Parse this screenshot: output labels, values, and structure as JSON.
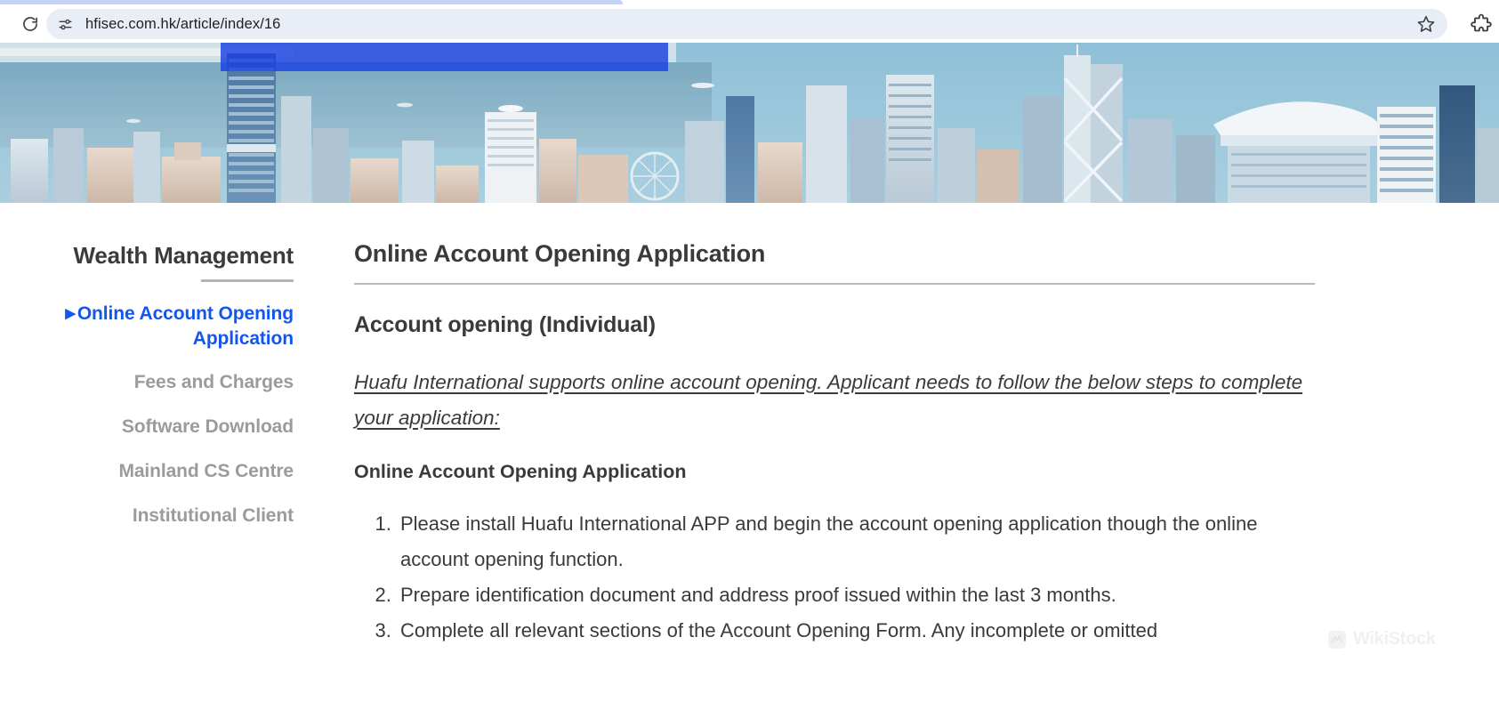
{
  "browser": {
    "reload_icon": "reload-icon",
    "site_info_icon": "site-info-icon",
    "url": "hfisec.com.hk/article/index/16",
    "bookmark_icon": "star-outline-icon",
    "extensions_icon": "puzzle-piece-icon"
  },
  "hero": {
    "alt": "Hong Kong Victoria Harbour skyline banner",
    "selection_color": "#1a3fe0"
  },
  "sidebar": {
    "title": "Wealth Management",
    "items": [
      {
        "label": "Online Account Opening Application",
        "active": true,
        "marker": "▶"
      },
      {
        "label": "Fees and Charges",
        "active": false
      },
      {
        "label": "Software Download",
        "active": false
      },
      {
        "label": "Mainland CS Centre",
        "active": false
      },
      {
        "label": "Institutional Client",
        "active": false
      }
    ],
    "active_color": "#1355ef",
    "inactive_color": "#9b9b9b"
  },
  "article": {
    "title": "Online Account Opening Application",
    "subtitle": "Account opening (Individual)",
    "intro": "Huafu International supports online account opening. Applicant needs to follow the below steps to complete your application:",
    "section_heading": "Online Account Opening Application",
    "steps": [
      "Please install Huafu International APP and begin the account opening application though the online account opening function.",
      "Prepare identification document and address proof issued within the last 3 months.",
      "Complete all relevant sections of the Account Opening Form. Any incomplete or omitted"
    ]
  },
  "watermark": {
    "text": "WikiStock"
  }
}
